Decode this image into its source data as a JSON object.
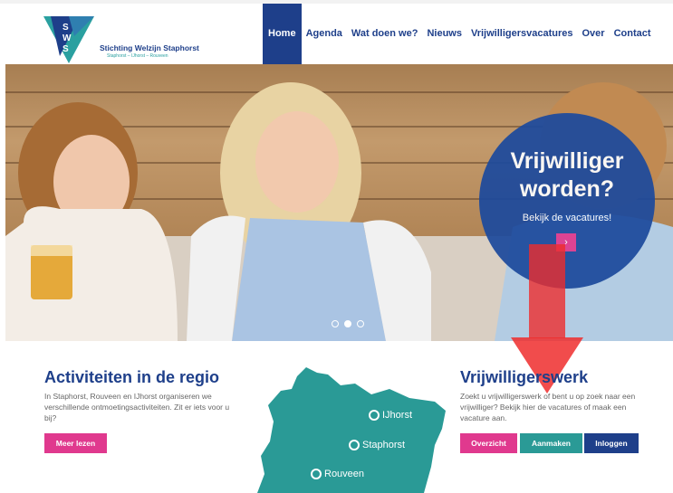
{
  "header": {
    "org_initials": [
      "S",
      "W",
      "S"
    ],
    "org_name": "Stichting Welzijn Staphorst",
    "org_tagline": "Staphorst – IJhorst – Rouveen",
    "nav": [
      {
        "label": "Home",
        "active": true
      },
      {
        "label": "Agenda"
      },
      {
        "label": "Wat doen we?"
      },
      {
        "label": "Nieuws"
      },
      {
        "label": "Vrijwilligersvacatures"
      },
      {
        "label": "Over"
      },
      {
        "label": "Contact"
      }
    ],
    "colors": {
      "brand_blue": "#1e3f8a",
      "teal": "#2a9a96",
      "pink": "#e0398e"
    }
  },
  "hero": {
    "circle_title_line1": "Vrijwilliger",
    "circle_title_line2": "worden?",
    "circle_subtitle": "Bekijk de vacatures!",
    "circle_button_icon": "chevron-right-icon",
    "circle_button_glyph": "›",
    "slides": 3,
    "active_slide": 2
  },
  "activiteiten": {
    "title": "Activiteiten in de regio",
    "text": "In Staphorst, Rouveen en IJhorst organiseren we verschillende ontmoetingsactiviteiten. Zit er iets voor u bij?",
    "button": "Meer lezen"
  },
  "map": {
    "towns": [
      "IJhorst",
      "Staphorst",
      "Rouveen"
    ]
  },
  "vrijwilligerswerk": {
    "title": "Vrijwilligerswerk",
    "text": "Zoekt u vrijwilligerswerk of bent u op zoek naar een vrijwilliger? Bekijk hier de vacatures of maak een vacature aan.",
    "buttons": [
      "Overzicht",
      "Aanmaken",
      "Inloggen"
    ]
  },
  "annotation": {
    "arrow_color": "#ee2d2d"
  }
}
